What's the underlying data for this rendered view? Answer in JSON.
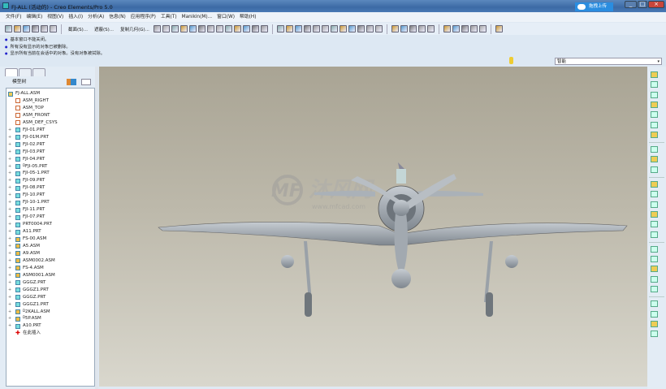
{
  "window": {
    "title": "FJ-ALL (活动的) - Creo Elements/Pro 5.0",
    "upload_label": "拖拽上传"
  },
  "menu": [
    "文件(F)",
    "编辑(E)",
    "视图(V)",
    "插入(I)",
    "分析(A)",
    "信息(N)",
    "应用程序(P)",
    "工具(T)",
    "Manikin(M)...",
    "窗口(W)",
    "帮助(H)"
  ],
  "toolbar": {
    "section_label": "截面(S)...",
    "view_label": "遮蔽(S)...",
    "copy_geom_label": "复制几何(G)..."
  },
  "messages": [
    "基本窗口不能关闭。",
    "所有没有显示的对象已被删除。",
    "显示所有当前在会话中的对象。没有对象被拭除。"
  ],
  "filter": {
    "value": "智能"
  },
  "model_tree": {
    "title": "模型树",
    "items": [
      {
        "label": "FJ-ALL.ASM",
        "type": "root"
      },
      {
        "label": "ASM_RIGHT",
        "type": "plane"
      },
      {
        "label": "ASM_TOP",
        "type": "plane"
      },
      {
        "label": "ASM_FRONT",
        "type": "plane"
      },
      {
        "label": "ASM_DEF_CSYS",
        "type": "csys"
      },
      {
        "label": "FJI-01.PRT",
        "type": "part"
      },
      {
        "label": "FJI-01M.PRT",
        "type": "part"
      },
      {
        "label": "FJI-02.PRT",
        "type": "part"
      },
      {
        "label": "FJI-03.PRT",
        "type": "part"
      },
      {
        "label": "FJI-04.PRT",
        "type": "part"
      },
      {
        "label": "FJI-05.PRT",
        "type": "part",
        "prefix": "D"
      },
      {
        "label": "FJI-05-1.PRT",
        "type": "part"
      },
      {
        "label": "FJI-09.PRT",
        "type": "part"
      },
      {
        "label": "FJI-08.PRT",
        "type": "part"
      },
      {
        "label": "FJI-10.PRT",
        "type": "part"
      },
      {
        "label": "FJI-10-1.PRT",
        "type": "part"
      },
      {
        "label": "FJI-11.PRT",
        "type": "part"
      },
      {
        "label": "FJI-07.PRT",
        "type": "part"
      },
      {
        "label": "PRT0004.PRT",
        "type": "part"
      },
      {
        "label": "A11.PRT",
        "type": "part"
      },
      {
        "label": "FS-00.ASM",
        "type": "asm"
      },
      {
        "label": "A5.ASM",
        "type": "asm"
      },
      {
        "label": "A9.ASM",
        "type": "asm"
      },
      {
        "label": "ASM0002.ASM",
        "type": "asm"
      },
      {
        "label": "FS-4.ASM",
        "type": "asm"
      },
      {
        "label": "ASM0001.ASM",
        "type": "asm"
      },
      {
        "label": "GGGZ.PRT",
        "type": "part"
      },
      {
        "label": "GGGZ1.PRT",
        "type": "part"
      },
      {
        "label": "GGGZ.PRT",
        "type": "part"
      },
      {
        "label": "GGGZ1.PRT",
        "type": "part"
      },
      {
        "label": "2KALL.ASM",
        "type": "asm",
        "prefix": "D"
      },
      {
        "label": "5P.ASM",
        "type": "asm",
        "prefix": "D"
      },
      {
        "label": "A10.PRT",
        "type": "part"
      },
      {
        "label": "在此插入",
        "type": "insert"
      }
    ]
  },
  "watermark": {
    "brand": "沐风网",
    "url": "www.mfcad.com"
  },
  "toolbar_icons": [
    "new-icon",
    "open-icon",
    "save-icon",
    "print-icon",
    "send-icon",
    "close-icon",
    "|",
    "section",
    "view",
    "copy-geom",
    "undo-icon",
    "redo-icon",
    "cut-icon",
    "copy-icon",
    "paste-icon",
    "paste-special-icon",
    "regen-icon",
    "regen-manager-icon",
    "find-icon",
    "layers-icon",
    "render-icon",
    "appearance-icon",
    "select-box-icon",
    "|",
    "repaint-icon",
    "spin-center-icon",
    "orient-icon",
    "shading-icon",
    "pan-icon",
    "zoom-in-icon",
    "zoom-out-icon",
    "refit-icon",
    "reorient-icon",
    "saved-views-icon",
    "layer-icon",
    "model-display-icon",
    "|",
    "wireframe-icon",
    "hidden-line-icon",
    "no-hidden-icon",
    "shaded-icon",
    "enhanced-realism-icon",
    "|",
    "datum-planes-icon",
    "datum-axes-icon",
    "datum-points-icon",
    "csys-icon",
    "annotations-icon",
    "|",
    "context-help-icon"
  ],
  "right_icons": [
    "sketch-icon",
    "plane-icon",
    "axis-icon",
    "curve-icon",
    "point-icon",
    "csys-icon",
    "analysis-icon",
    "|",
    "component-icon",
    "create-component-icon",
    "assemble-icon",
    "|",
    "extrude-icon",
    "revolve-icon",
    "sweep-icon",
    "blend-icon",
    "hole-icon",
    "round-icon",
    "|",
    "pattern-icon",
    "mirror-icon",
    "trim-icon",
    "merge-icon",
    "offset-icon",
    "|",
    "draft-icon",
    "shell-icon",
    "rib-icon",
    "grid-icon"
  ]
}
